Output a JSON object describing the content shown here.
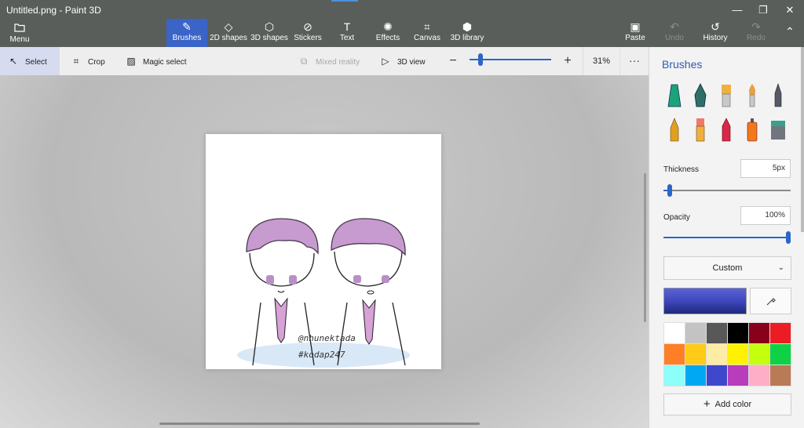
{
  "window": {
    "title": "Untitled.png - Paint 3D",
    "controls": [
      "—",
      "❐",
      "✕"
    ]
  },
  "toolbar": {
    "menu_label": "Menu",
    "tools": [
      {
        "label": "Brushes",
        "icon": "brush-icon",
        "glyph": "✎",
        "active": true
      },
      {
        "label": "2D shapes",
        "icon": "2d-shapes-icon",
        "glyph": "◇"
      },
      {
        "label": "3D shapes",
        "icon": "3d-shapes-icon",
        "glyph": "⬡"
      },
      {
        "label": "Stickers",
        "icon": "stickers-icon",
        "glyph": "⊘"
      },
      {
        "label": "Text",
        "icon": "text-icon",
        "glyph": "T"
      },
      {
        "label": "Effects",
        "icon": "effects-icon",
        "glyph": "✺"
      },
      {
        "label": "Canvas",
        "icon": "canvas-icon",
        "glyph": "⌗"
      },
      {
        "label": "3D library",
        "icon": "3d-library-icon",
        "glyph": "⬢"
      }
    ],
    "paste_label": "Paste",
    "undo_label": "Undo",
    "history_label": "History",
    "redo_label": "Redo"
  },
  "subbar": {
    "select_label": "Select",
    "crop_label": "Crop",
    "magic_select_label": "Magic select",
    "mixed_reality_label": "Mixed reality",
    "view_3d_label": "3D view",
    "zoom_value": "31%",
    "zoom_level": 0.13,
    "more": "···"
  },
  "canvas": {
    "handle": "@nhunektada",
    "hashtag": "#kodap247"
  },
  "panel": {
    "title": "Brushes",
    "brushes": [
      {
        "name": "marker-icon",
        "color": "#1aa37a"
      },
      {
        "name": "calligraphy-pen-icon",
        "color": "#2f6f6a"
      },
      {
        "name": "oil-brush-icon",
        "color": "#f0b040"
      },
      {
        "name": "watercolor-icon",
        "color": "#e8a040"
      },
      {
        "name": "pixel-pen-icon",
        "color": "#555a66"
      },
      {
        "name": "pencil-icon",
        "color": "#e0a020"
      },
      {
        "name": "eraser-icon",
        "color": "#f0786a"
      },
      {
        "name": "crayon-icon",
        "color": "#d8294a"
      },
      {
        "name": "spray-can-icon",
        "color": "#f07a1a"
      },
      {
        "name": "fill-icon",
        "color": "#3aa08a"
      }
    ],
    "thickness_label": "Thickness",
    "thickness_value": "5px",
    "thickness_level": 0.05,
    "opacity_label": "Opacity",
    "opacity_value": "100%",
    "opacity_level": 1.0,
    "finish_dropdown": "Custom",
    "current_color": "#3b44b8",
    "palette": [
      "#ffffff",
      "#c3c3c3",
      "#585858",
      "#000000",
      "#88001b",
      "#ec1c24",
      "#ff7f27",
      "#ffca18",
      "#fdeca6",
      "#fff200",
      "#c4ff0e",
      "#0ed145",
      "#8cfffb",
      "#00a8f3",
      "#3f48cc",
      "#b83dba",
      "#ffaec8",
      "#b97a56"
    ],
    "add_color_label": "Add color"
  }
}
